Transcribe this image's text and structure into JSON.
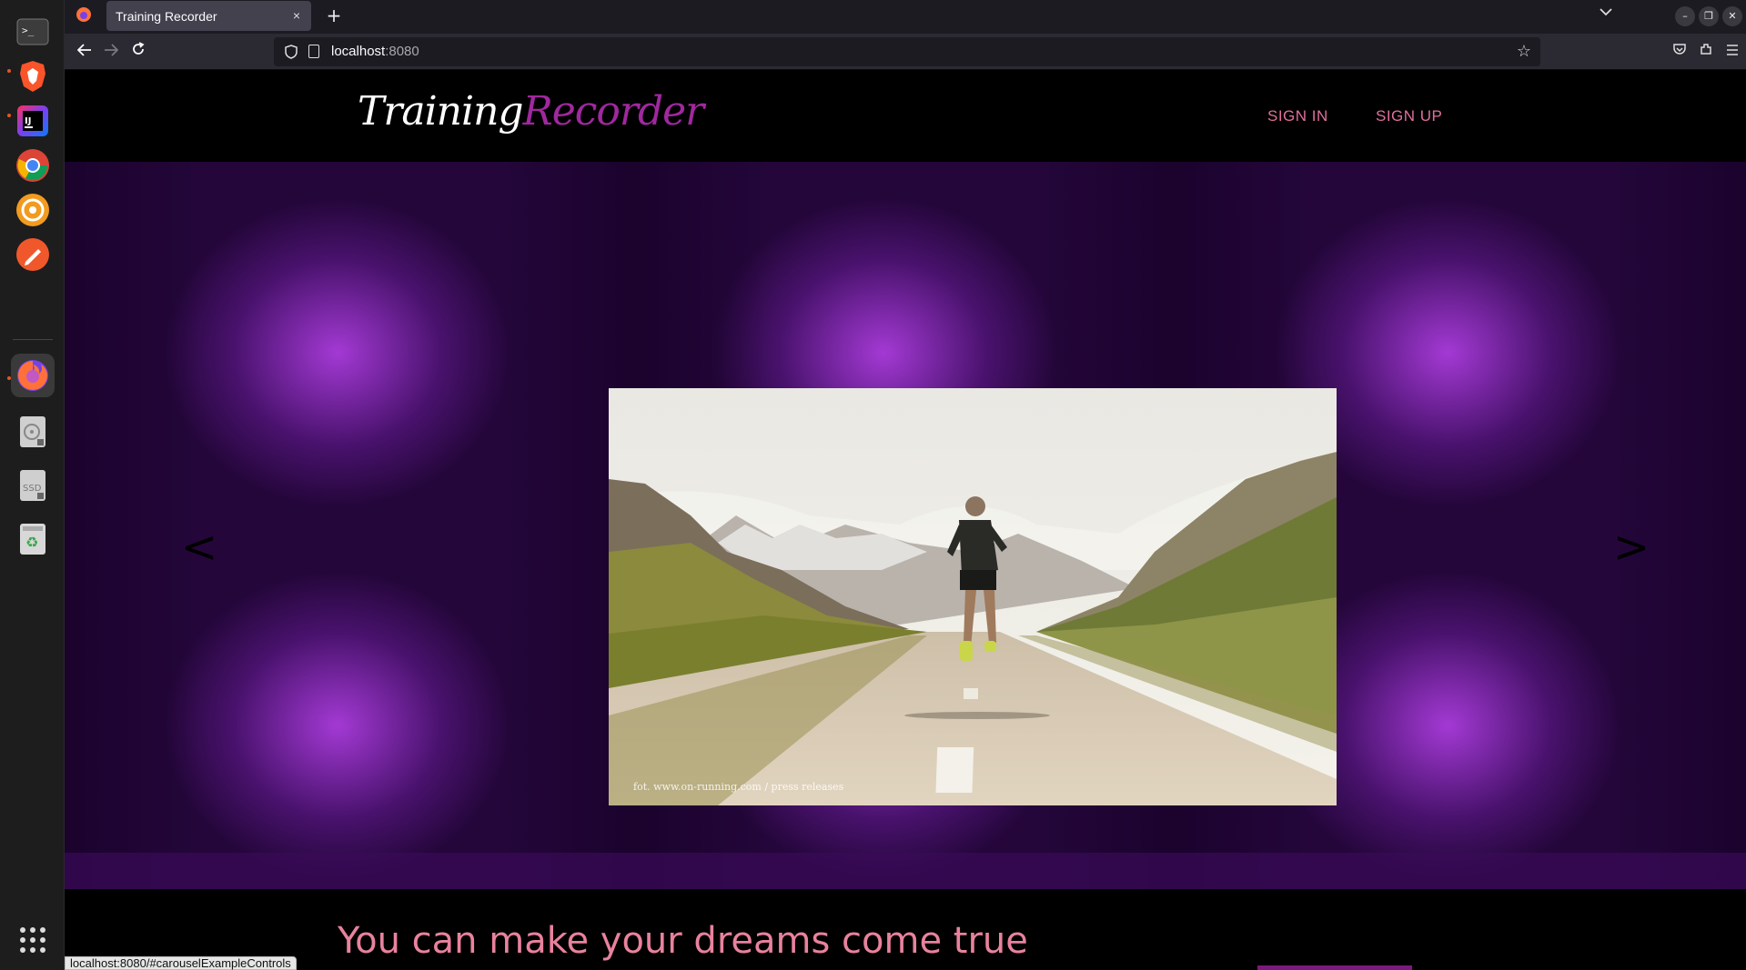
{
  "browser": {
    "tab_title": "Training Recorder",
    "tab_close_glyph": "×",
    "new_tab_glyph": "+",
    "url_host": "localhost",
    "url_port": ":8080",
    "status_link": "localhost:8080/#carouselExampleControls"
  },
  "dock": {
    "items": [
      "terminal-icon",
      "brave-icon",
      "intellij-icon",
      "chrome-icon",
      "paw-icon",
      "editor-icon",
      "firefox-icon",
      "disk-icon",
      "ssd-icon",
      "trash-icon"
    ]
  },
  "site": {
    "logo_white": "Training",
    "logo_purple": "Recorder",
    "nav": {
      "sign_in": "SIGN IN",
      "sign_up": "SIGN UP"
    },
    "carousel": {
      "prev_glyph": "<",
      "next_glyph": ">",
      "caption": "fot. www.on-running.com / press releases"
    },
    "tagline": "You can make your dreams come true"
  },
  "colors": {
    "accent_pink": "#e0709a",
    "logo_purple": "#a0289e",
    "carousel_purple": "#8a2bc0"
  }
}
